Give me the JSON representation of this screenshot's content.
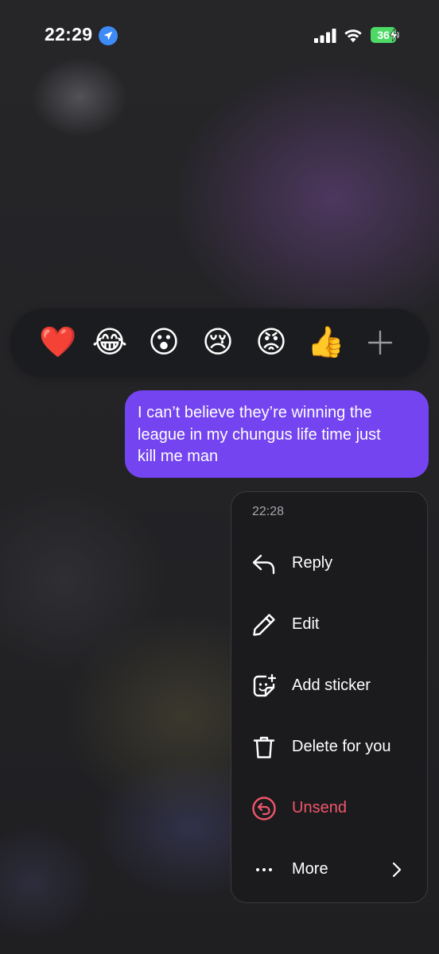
{
  "status_bar": {
    "time": "22:29",
    "battery_level": "36",
    "location_icon": "location-arrow-icon",
    "signal_icon": "cellular-signal-icon",
    "wifi_icon": "wifi-icon",
    "charging_icon": "charging-bolt-icon"
  },
  "reactions": [
    {
      "name": "heart",
      "emoji": "❤️"
    },
    {
      "name": "laugh",
      "emoji": "😂"
    },
    {
      "name": "wow",
      "emoji": "😮"
    },
    {
      "name": "cry",
      "emoji": "😢"
    },
    {
      "name": "angry",
      "emoji": "😡"
    },
    {
      "name": "thumbs-up",
      "emoji": "👍"
    }
  ],
  "message": {
    "text": "I can’t believe they’re winning the\nleague in my chungus life time just\nkill me man",
    "bubble_color": "#7444f0"
  },
  "menu": {
    "timestamp": "22:28",
    "items": [
      {
        "label": "Reply",
        "icon": "reply-arrow-icon"
      },
      {
        "label": "Edit",
        "icon": "pencil-icon"
      },
      {
        "label": "Add sticker",
        "icon": "sticker-icon"
      },
      {
        "label": "Delete for you",
        "icon": "trash-icon"
      },
      {
        "label": "Unsend",
        "icon": "unsend-icon",
        "color": "#f0566a"
      },
      {
        "label": "More",
        "icon": "ellipsis-icon"
      }
    ],
    "more_chevron": "chevron-right-icon"
  },
  "colors": {
    "accent": "#7444f0",
    "danger": "#f0566a",
    "battery": "#4cd964",
    "location": "#3d8bf6"
  }
}
